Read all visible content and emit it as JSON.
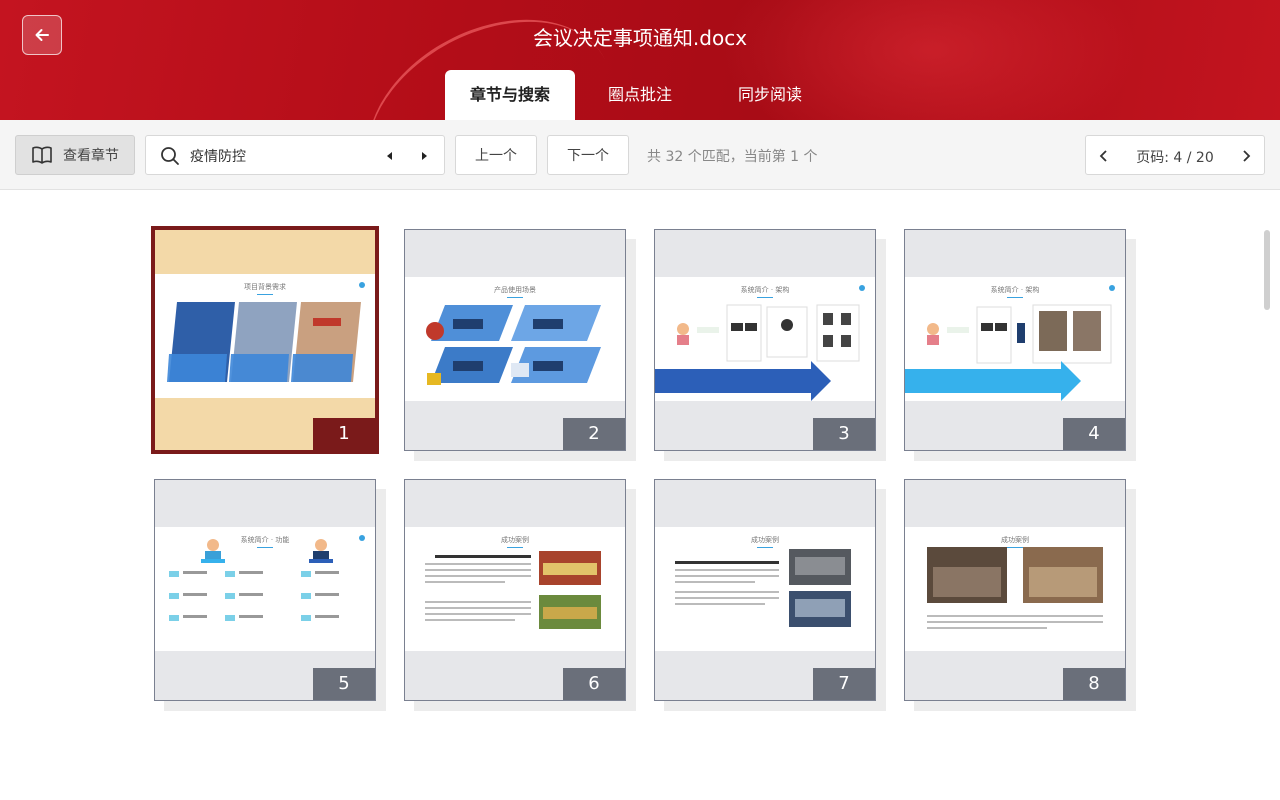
{
  "header": {
    "title": "会议决定事项通知.docx",
    "back_icon": "arrow-left-icon",
    "tabs": [
      {
        "label": "章节与搜索",
        "active": true
      },
      {
        "label": "圈点批注",
        "active": false
      },
      {
        "label": "同步阅读",
        "active": false
      }
    ],
    "accent_color": "#b80f1a"
  },
  "toolbar": {
    "chapter_button_label": "查看章节",
    "search": {
      "value": "疫情防控"
    },
    "prev_label": "上一个",
    "next_label": "下一个",
    "match_text": "共 32 个匹配，当前第 1 个",
    "page_text": "页码: 4 / 20"
  },
  "thumbnails": [
    {
      "number": "1",
      "title": "项目背景需求",
      "selected": true
    },
    {
      "number": "2",
      "title": "产品使用场景",
      "selected": false
    },
    {
      "number": "3",
      "title": "系统简介 · 架构",
      "selected": false
    },
    {
      "number": "4",
      "title": "系统简介 · 架构",
      "selected": false
    },
    {
      "number": "5",
      "title": "系统简介 · 功能",
      "selected": false
    },
    {
      "number": "6",
      "title": "成功案例",
      "selected": false
    },
    {
      "number": "7",
      "title": "成功案例",
      "selected": false
    },
    {
      "number": "8",
      "title": "成功案例",
      "selected": false
    }
  ],
  "selected_color": "#7a1a1a"
}
